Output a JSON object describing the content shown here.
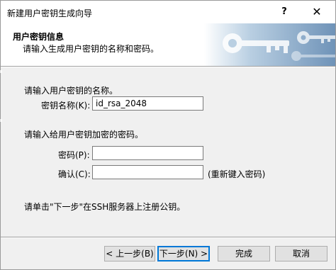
{
  "window": {
    "title": "新建用户密钥生成向导",
    "help": "?",
    "close": "✕"
  },
  "header": {
    "title": "用户密钥信息",
    "subtitle": "请输入生成用户密钥的名称和密码。"
  },
  "name_section": {
    "prompt": "请输入用户密钥的名称。",
    "key_name_label": "密钥名称(K):",
    "key_name_value": "id_rsa_2048"
  },
  "password_section": {
    "prompt": "请输入给用户密钥加密的密码。",
    "password_label": "密码(P):",
    "password_value": "",
    "confirm_label": "确认(C):",
    "confirm_value": "",
    "confirm_hint": "(重新键入密码)"
  },
  "footer_note": "请单击\"下一步\"在SSH服务器上注册公钥。",
  "buttons": {
    "back": "< 上一步(B)",
    "next": "下一步(N) >",
    "finish": "完成",
    "cancel": "取消"
  },
  "colors": {
    "accent": "#0078d7",
    "header_art": "#a9c4dc"
  }
}
